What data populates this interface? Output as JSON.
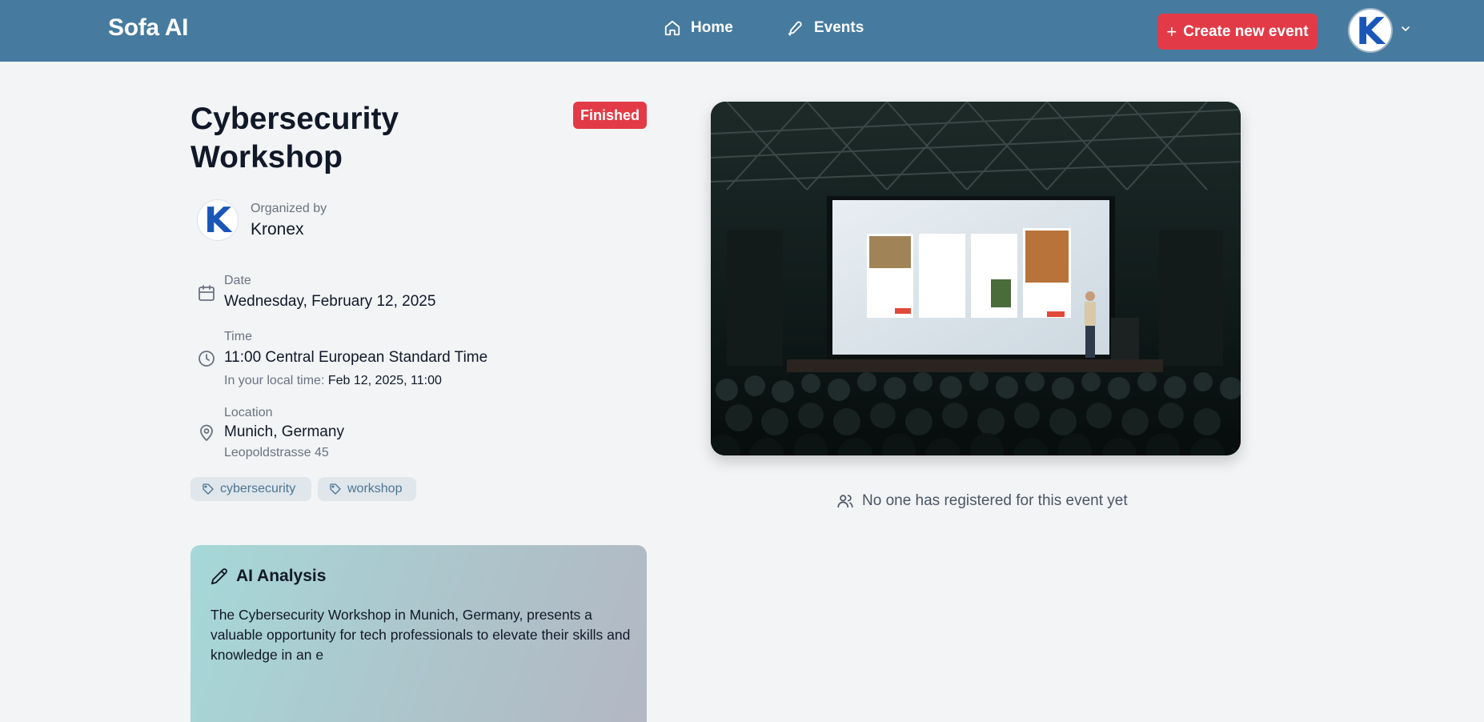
{
  "header": {
    "brand": "Sofa AI",
    "nav": [
      {
        "label": "Home",
        "icon": "home-icon"
      },
      {
        "label": "Events",
        "icon": "pen-icon"
      }
    ],
    "create_button_label": "Create new event",
    "create_button_icon": "plus-icon",
    "avatar_letter": "K"
  },
  "event": {
    "title": "Cybersecurity Workshop",
    "status": "Finished",
    "organizer_label": "Organized by",
    "organizer_name": "Kronex",
    "organizer_avatar_letter": "K",
    "date_label": "Date",
    "date_value": "Wednesday, February 12, 2025",
    "time_label": "Time",
    "time_value": "11:00 Central European Standard Time",
    "local_time_prefix": "In your local time:",
    "local_time_value": "Feb 12, 2025, 11:00",
    "location_label": "Location",
    "location_value": "Munich, Germany",
    "location_address": "Leopoldstrasse 45",
    "tags": [
      "cybersecurity",
      "workshop"
    ]
  },
  "ai_analysis": {
    "title": "AI Analysis",
    "text": "The Cybersecurity Workshop in Munich, Germany, presents a valuable opportunity for tech professionals to elevate their skills and knowledge in an e"
  },
  "registrations_text": "No one has registered for this event yet",
  "colors": {
    "header_bg": "#467b9f",
    "accent_red": "#e23b47",
    "page_bg": "#f2f4f6",
    "tag_bg": "#dfe6ec",
    "tag_text": "#4c7590"
  }
}
